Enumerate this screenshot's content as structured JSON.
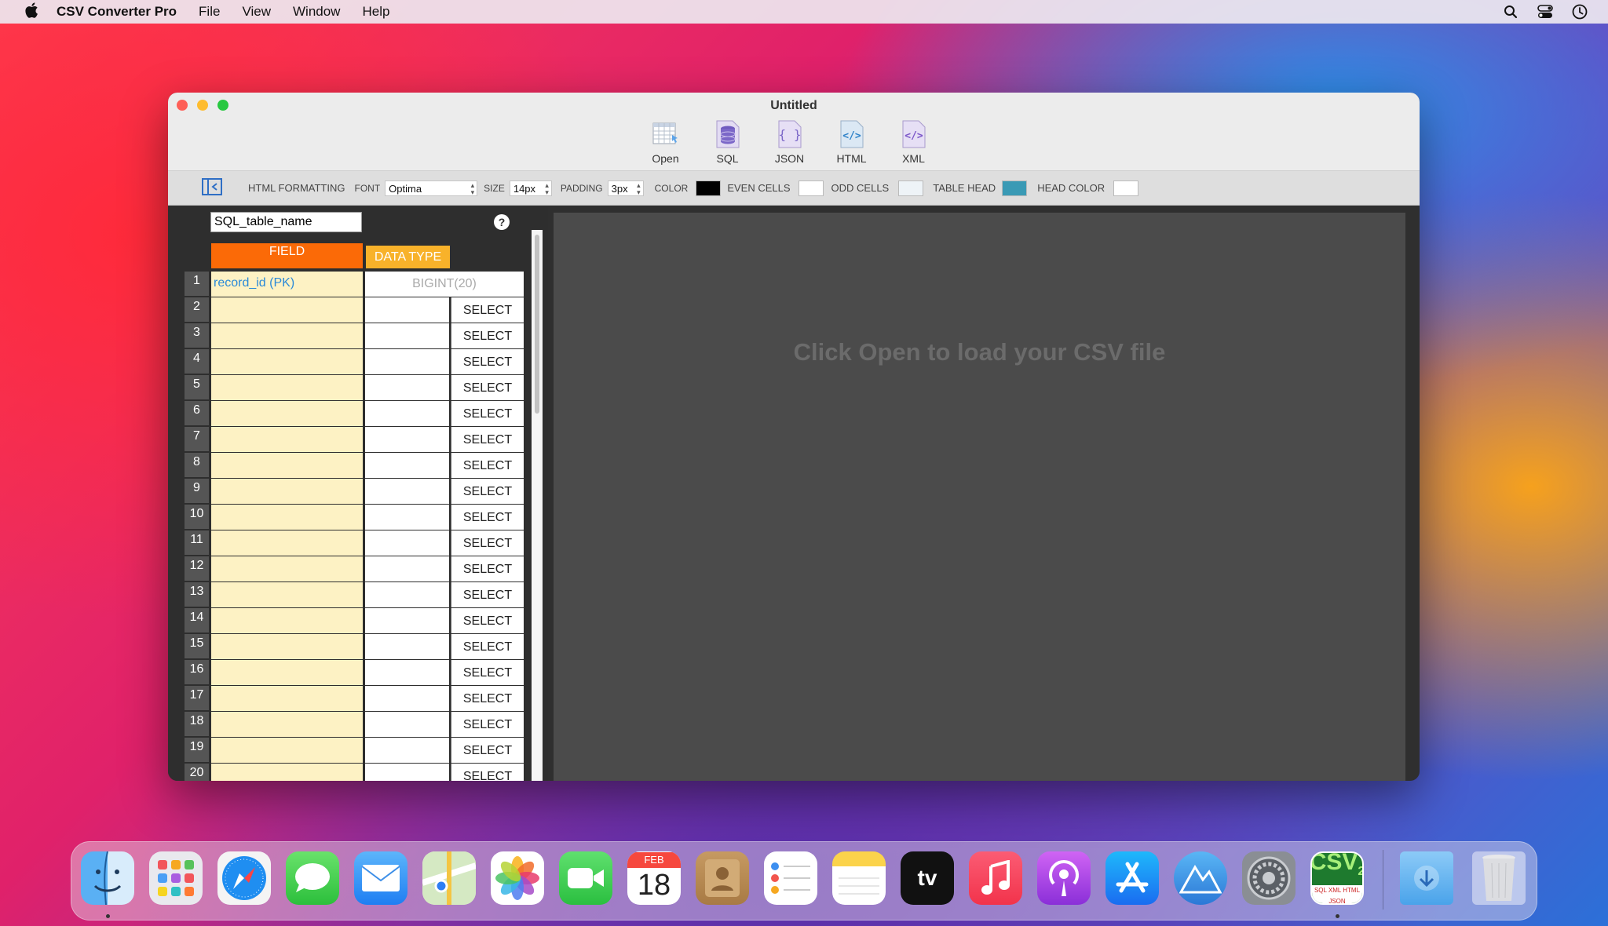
{
  "menubar": {
    "app_name": "CSV Converter Pro",
    "menus": [
      "File",
      "View",
      "Window",
      "Help"
    ]
  },
  "window": {
    "title": "Untitled"
  },
  "toolbar": {
    "items": [
      {
        "label": "Open",
        "icon": "table-icon"
      },
      {
        "label": "SQL",
        "icon": "database-icon"
      },
      {
        "label": "JSON",
        "icon": "braces-icon"
      },
      {
        "label": "HTML",
        "icon": "code-icon"
      },
      {
        "label": "XML",
        "icon": "code-icon"
      }
    ]
  },
  "format": {
    "label": "HTML FORMATTING",
    "font_label": "FONT",
    "font_value": "Optima",
    "size_label": "SIZE",
    "size_value": "14px",
    "padding_label": "PADDING",
    "padding_value": "3px",
    "color_label": "COLOR",
    "even_label": "EVEN CELLS",
    "odd_label": "ODD CELLS",
    "head_label": "TABLE HEAD",
    "head_color_label": "HEAD COLOR",
    "colors": {
      "color": "#000000",
      "even": "#ffffff",
      "odd": "#eef3f7",
      "head": "#3a9ab5",
      "head_color": "#ffffff"
    }
  },
  "schema": {
    "table_name": "SQL_table_name",
    "help": "?",
    "field_header": "FIELD",
    "dtype_header": "DATA TYPE",
    "first_row": {
      "num": "1",
      "field": "record_id (PK)",
      "dtype": "BIGINT(20)"
    },
    "select_label": "SELECT",
    "row_numbers": [
      "2",
      "3",
      "4",
      "5",
      "6",
      "7",
      "8",
      "9",
      "10",
      "11",
      "12",
      "13",
      "14",
      "15",
      "16",
      "17",
      "18",
      "19",
      "20"
    ]
  },
  "main": {
    "placeholder": "Click Open to load your CSV file"
  },
  "dock": {
    "calendar_month": "FEB",
    "calendar_day": "18",
    "csv_label": "CSV",
    "csv_sub": "2",
    "csv_formats": "SQL XML HTML JSON",
    "apps": [
      "finder",
      "launchpad",
      "safari",
      "messages",
      "mail",
      "maps",
      "photos",
      "facetime",
      "calendar",
      "contacts",
      "reminders",
      "notes",
      "apple-tv",
      "music",
      "podcasts",
      "app-store",
      "altimeter",
      "system-preferences",
      "csv-converter",
      "downloads",
      "trash"
    ]
  }
}
